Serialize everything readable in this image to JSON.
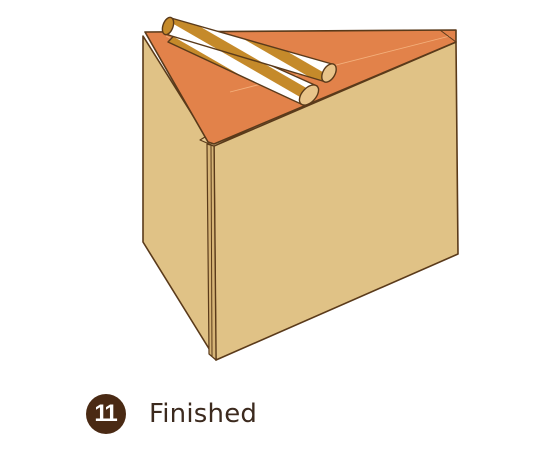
{
  "step": {
    "number": "11",
    "label": "Finished"
  },
  "colors": {
    "box_face": "#e0c286",
    "box_top": "#e2824a",
    "outline": "#5a3a1a",
    "straw_stripe": "#c58a2a",
    "straw_base": "#ffffff",
    "badge": "#4a2a14"
  }
}
